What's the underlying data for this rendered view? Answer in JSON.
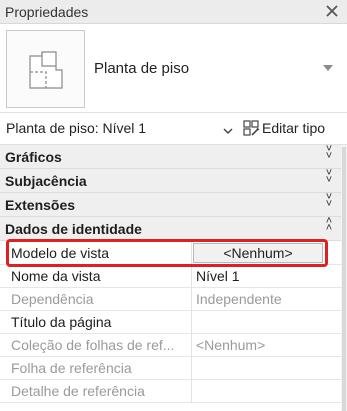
{
  "panel": {
    "title": "Propriedades"
  },
  "type_selector": {
    "type_name": "Planta de piso"
  },
  "instance": {
    "label": "Planta de piso: Nível 1",
    "edit_type_label": "Editar tipo"
  },
  "categories": [
    {
      "label": "Gráficos",
      "expander": "˅"
    },
    {
      "label": "Subjacência",
      "expander": "˅"
    },
    {
      "label": "Extensões",
      "expander": "˅"
    },
    {
      "label": "Dados de identidade",
      "expander": "˄"
    }
  ],
  "rows": [
    {
      "name": "Modelo de vista",
      "value": "<Nenhum>",
      "enabled": true,
      "is_button": true,
      "highlighted": true
    },
    {
      "name": "Nome da vista",
      "value": "Nível 1",
      "enabled": true
    },
    {
      "name": "Dependência",
      "value": "Independente",
      "enabled": false
    },
    {
      "name": "Título da página",
      "value": "",
      "enabled": true
    },
    {
      "name": "Coleção de folhas de ref...",
      "value": "<Nenhum>",
      "enabled": false
    },
    {
      "name": "Folha de referência",
      "value": "",
      "enabled": false
    },
    {
      "name": "Detalhe de referência",
      "value": "",
      "enabled": false
    }
  ],
  "colors": {
    "highlight": "#e02020",
    "category_bg": "#efefef",
    "disabled_text": "#9a9a9a"
  }
}
